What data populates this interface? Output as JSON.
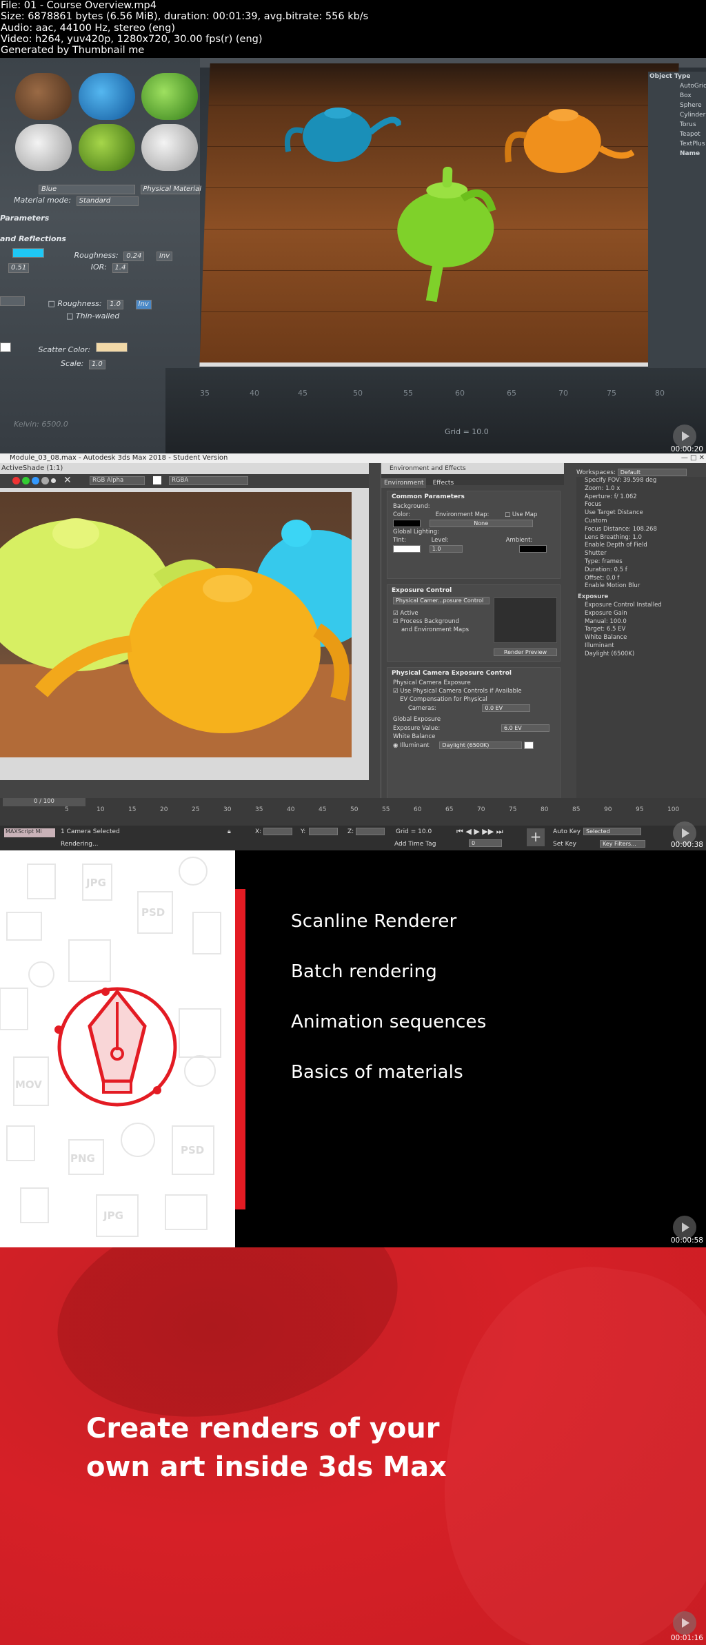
{
  "header": {
    "lines": [
      "File: 01 - Course Overview.mp4",
      "Size: 6878861 bytes (6.56 MiB), duration: 00:01:39, avg.bitrate: 556 kb/s",
      "Audio: aac, 44100 Hz, stereo (eng)",
      "Video: h264, yuv420p, 1280x720, 30.00 fps(r) (eng)",
      "Generated by Thumbnail me"
    ]
  },
  "frame1": {
    "timestamp": "00:00:20",
    "material_name": "Blue",
    "material_type": "Physical Material",
    "material_mode_label": "Material mode:",
    "material_mode_value": "Standard",
    "parameters_heading": "Parameters",
    "reflections_heading": "and Reflections",
    "roughness_label": "Roughness:",
    "roughness_value": "0.24",
    "inv_label": "Inv",
    "ior_label": "IOR:",
    "ior_value": "1.4",
    "left_value": "0.51",
    "roughness2_label": "Roughness:",
    "roughness2_value": "1.0",
    "thin_walled_label": "Thin-walled",
    "scatter_label": "Scatter Color:",
    "scale_label": "Scale:",
    "scale_value": "1.0",
    "kelvin_label": "Kelvin: 6500.0",
    "grid_label": "Grid = 10.0",
    "object_type_items": [
      "Object Type",
      "AutoGrid",
      "Box",
      "Sphere",
      "Cylinder",
      "Torus",
      "Teapot",
      "TextPlus",
      "Name"
    ],
    "ruler_ticks": [
      "35",
      "40",
      "45",
      "50",
      "55",
      "60",
      "65",
      "70",
      "75",
      "80"
    ],
    "colors": {
      "scatter_swatch": "#f2d9a8",
      "color_swatch": "#1fc7f5"
    }
  },
  "frame2": {
    "timestamp": "00:00:38",
    "title": "Module_03_08.max - Autodesk 3ds Max 2018 - Student Version",
    "renderwin_title": "ActiveShade (1:1)",
    "channel_select": "RGB Alpha",
    "display_select": "RGBA",
    "env": {
      "title": "Environment and Effects",
      "tabs": [
        "Environment",
        "Effects"
      ],
      "common_params": "Common Parameters",
      "background": "Background:",
      "color_label": "Color:",
      "env_map_label": "Environment Map:",
      "use_map": "Use Map",
      "none_btn": "None",
      "global_lighting": "Global Lighting:",
      "tint": "Tint:",
      "level": "Level:",
      "level_value": "1.0",
      "ambient": "Ambient:",
      "exposure_control": "Exposure Control",
      "exposure_select": "Physical Camer...posure Control",
      "active": "Active",
      "process_bg": "Process Background",
      "process_bg2": "and Environment Maps",
      "render_preview": "Render Preview",
      "phys_cam_exp": "Physical Camera Exposure Control",
      "phys_cam_exp_sub": "Physical Camera Exposure",
      "use_phys_cam": "Use Physical Camera Controls if Available",
      "ev_comp": "EV Compensation for Physical",
      "cameras": "Cameras:",
      "ev_comp_value": "0.0 EV",
      "global_exposure": "Global Exposure",
      "exposure_value_label": "Exposure Value:",
      "exposure_value": "6.0 EV",
      "white_balance": "White Balance",
      "illuminant": "Illuminant",
      "illuminant_value": "Daylight (6500K)"
    },
    "workspaces_label": "Workspaces:",
    "workspaces_value": "Default",
    "right_panel": [
      "Specify FOV: 39.598 deg",
      "Zoom: 1.0 x",
      "Aperture: f/ 1.062",
      "Focus",
      "Use Target Distance",
      "Custom",
      "Focus Distance: 108.268",
      "Lens Breathing: 1.0",
      "Enable Depth of Field",
      "Shutter",
      "Type: frames",
      "Duration: 0.5 f",
      "Offset: 0.0 f",
      "Enable Motion Blur",
      "Exposure",
      "Exposure Control Installed",
      "Exposure Gain",
      "Manual: 100.0",
      "Target: 6.5 EV",
      "White Balance",
      "Illuminant",
      "Daylight (6500K)"
    ],
    "timeline_counter": "0 / 100",
    "timeline_ticks": [
      "5",
      "10",
      "15",
      "20",
      "25",
      "30",
      "35",
      "40",
      "45",
      "50",
      "55",
      "60",
      "65",
      "70",
      "75",
      "80",
      "85",
      "90",
      "95",
      "100"
    ],
    "maxscript": "MAXScript Mi",
    "status_selected": "1 Camera Selected",
    "status_rendering": "Rendering...",
    "x_label": "X:",
    "y_label": "Y:",
    "z_label": "Z:",
    "grid": "Grid = 10.0",
    "add_time_tag": "Add Time Tag",
    "auto_key": "Auto Key",
    "set_key": "Set Key",
    "selected": "Selected",
    "key_filters": "Key Filters...",
    "frame_value": "0"
  },
  "frame3": {
    "timestamp": "00:00:58",
    "items": [
      "Scanline Renderer",
      "Batch rendering",
      "Animation sequences",
      "Basics of materials"
    ],
    "pattern_labels": [
      "JPG",
      "PSD",
      "MOV",
      "PNG",
      "PSD",
      "JPG"
    ],
    "colors": {
      "accent": "#e31b23"
    }
  },
  "frame4": {
    "timestamp": "00:01:16",
    "line1": "Create renders of your",
    "line2": "own art inside 3ds Max",
    "colors": {
      "background": "#d62027"
    }
  }
}
